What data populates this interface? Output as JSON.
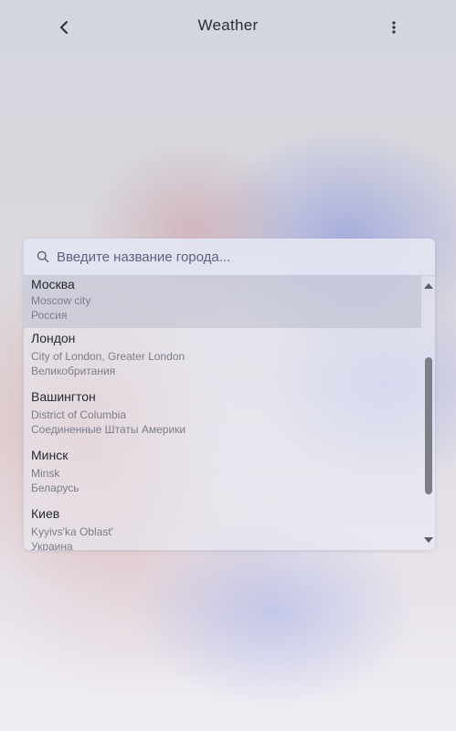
{
  "header": {
    "title": "Weather",
    "back_icon": "chevron-left-icon",
    "menu_icon": "more-vertical-icon"
  },
  "search": {
    "placeholder": "Введите название города...",
    "value": "",
    "icon": "search-icon"
  },
  "cities": [
    {
      "name": "Москва",
      "region": "Moscow city",
      "country": "Россия",
      "highlighted": true
    },
    {
      "name": "Лондон",
      "region": "City of London, Greater London",
      "country": "Великобритания"
    },
    {
      "name": "Вашингтон",
      "region": "District of Columbia",
      "country": "Соединенные Штаты Америки"
    },
    {
      "name": "Минск",
      "region": "Minsk",
      "country": "Беларусь"
    },
    {
      "name": "Киев",
      "region": "Kyyivs'ka Oblast'",
      "country": "Украина"
    }
  ],
  "colors": {
    "text_primary": "#262a33",
    "text_secondary": "#7a7d8c",
    "scroll_thumb": "#7d7f87"
  }
}
